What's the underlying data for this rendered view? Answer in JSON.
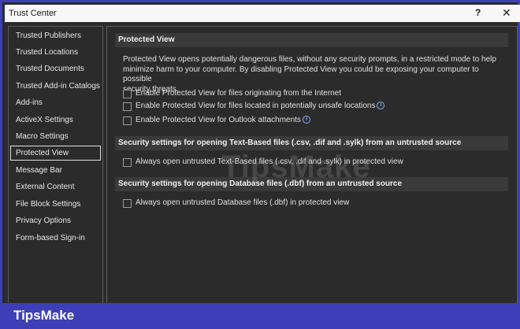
{
  "window": {
    "title": "Trust Center",
    "help": "?",
    "close": "✕"
  },
  "sidebar": {
    "items": [
      {
        "label": "Trusted Publishers"
      },
      {
        "label": "Trusted Locations"
      },
      {
        "label": "Trusted Documents"
      },
      {
        "label": "Trusted Add-in Catalogs"
      },
      {
        "label": "Add-ins"
      },
      {
        "label": "ActiveX Settings"
      },
      {
        "label": "Macro Settings"
      },
      {
        "label": "Protected View",
        "selected": true
      },
      {
        "label": "Message Bar"
      },
      {
        "label": "External Content"
      },
      {
        "label": "File Block Settings"
      },
      {
        "label": "Privacy Options"
      },
      {
        "label": "Form-based Sign-in"
      }
    ]
  },
  "main": {
    "protected_view": {
      "header": "Protected View",
      "desc_lines": [
        "Protected View opens potentially dangerous files, without any security prompts, in a restricted mode to help",
        "minimize harm to your computer. By disabling Protected View you could be exposing your computer to possible",
        "security threats."
      ],
      "options": [
        {
          "label": "Enable Protected View for files originating from the Internet",
          "checked": false
        },
        {
          "label": "Enable Protected View for files located in potentially unsafe locations",
          "checked": false,
          "info": "i"
        },
        {
          "label": "Enable Protected View for Outlook attachments",
          "checked": false,
          "info": "i"
        }
      ]
    },
    "text_based": {
      "header": "Security settings for opening Text-Based files (.csv, .dif and .sylk) from an untrusted source",
      "option": {
        "label": "Always open untrusted Text-Based files (.csv, .dif and .sylk) in protected view",
        "checked": false
      }
    },
    "database": {
      "header": "Security settings for opening Database files (.dbf) from an untrusted source",
      "option": {
        "label": "Always open untrusted Database files (.dbf) in protected view",
        "checked": false
      }
    }
  },
  "watermark": "TipsMake",
  "footer": {
    "brand": "TipsMake"
  },
  "colors": {
    "accent": "#3d3fb8",
    "background": "#2b2b2b",
    "header_bg": "#3a3a3a",
    "info": "#8ab4f8"
  }
}
